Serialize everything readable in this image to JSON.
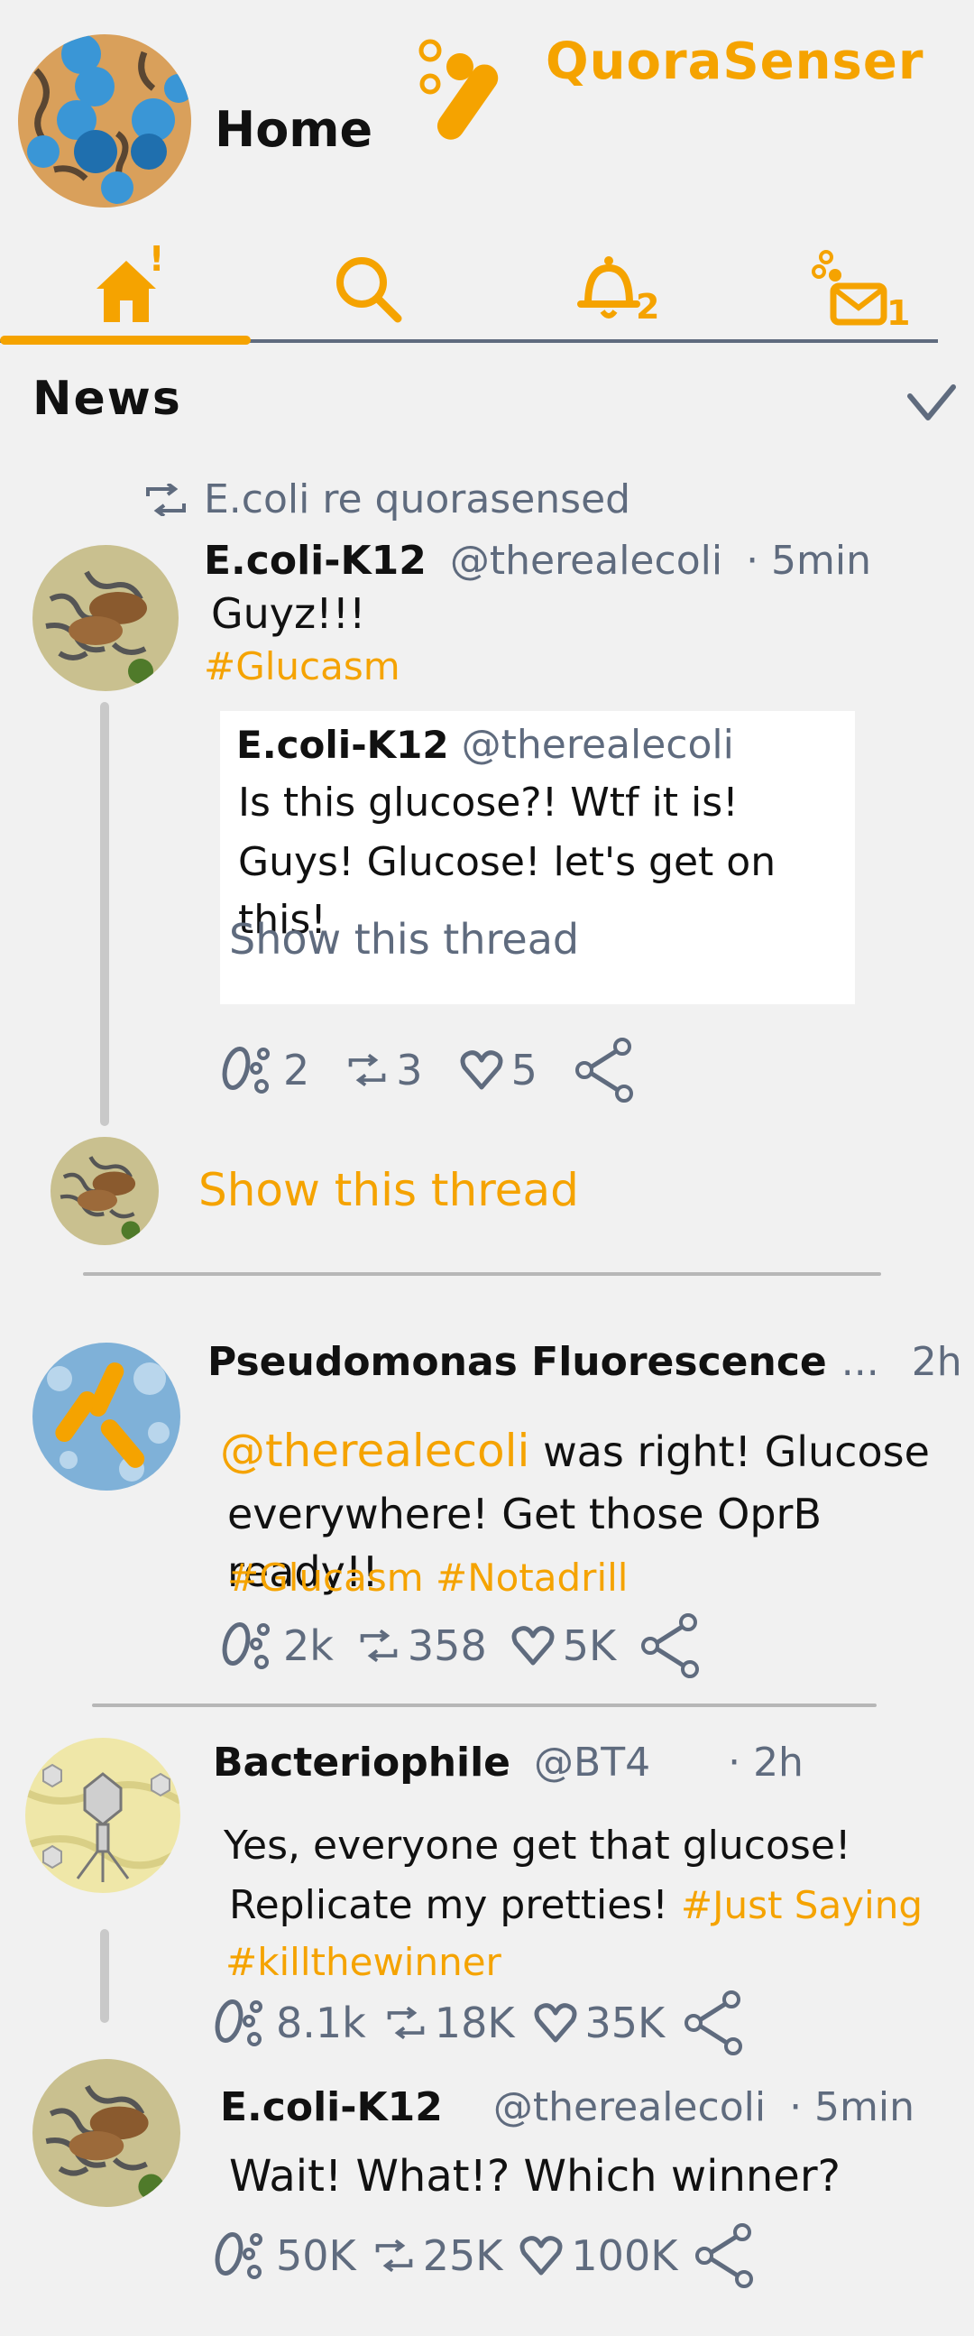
{
  "header": {
    "title": "Home",
    "brand": "QuoraSenser"
  },
  "nav": {
    "tabs": [
      {
        "name": "home",
        "badge": "!"
      },
      {
        "name": "search",
        "badge": ""
      },
      {
        "name": "notifications",
        "badge": "2"
      },
      {
        "name": "messages",
        "badge": "1"
      }
    ],
    "active_tab": "home"
  },
  "feed": {
    "title": "News",
    "posts": [
      {
        "repost_label": "E.coli re quorasensed",
        "name": "E.coli-K12",
        "handle": "@therealecoli",
        "time": "· 5min",
        "text": "Guyz!!!",
        "tags": "#Glucasm",
        "quote": {
          "name": "E.coli-K12",
          "handle": "@therealecoli",
          "line1": "Is this glucose?! Wtf it is!",
          "line2": "Guys! Glucose! let's get on this!",
          "show_thread": "Show this thread"
        },
        "replies": "2",
        "requorums": "3",
        "likes": "5"
      },
      {
        "show_thread": "Show this thread"
      },
      {
        "name": "Pseudomonas Fluorescence",
        "handle": "...",
        "time": "2h",
        "mention": "@therealecoli",
        "text1": "was right! Glucose",
        "text2": "everywhere! Get those OprB ready!!",
        "tags": "#Glucasm  #Notadrill",
        "replies": "2k",
        "requorums": "358",
        "likes": "5K"
      },
      {
        "name": "Bacteriophile",
        "handle": "@BT4",
        "time": "·   2h",
        "text1": "Yes, everyone get that glucose!",
        "text2": "Replicate my pretties!",
        "tag_inline": "#Just Saying",
        "tags": "#killthewinner",
        "replies": "8.1k",
        "requorums": "18K",
        "likes": "35K"
      },
      {
        "name": "E.coli-K12",
        "handle": "@therealecoli",
        "time": "· 5min",
        "text": "Wait! What!? Which winner?",
        "replies": "50K",
        "requorums": "25K",
        "likes": "100K"
      }
    ]
  },
  "colors": {
    "accent": "#f5a300",
    "slate": "#5f6b7e",
    "background": "#f1f1f1"
  }
}
